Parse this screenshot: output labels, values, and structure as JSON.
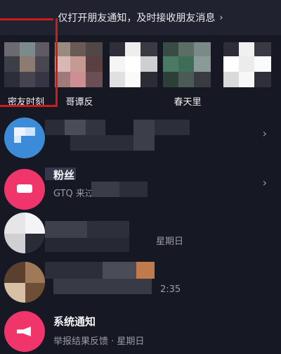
{
  "notification_banner": {
    "text": "仅打开朋友通知，及时接收朋友消息",
    "chevron": "chevron-right-icon"
  },
  "stories": [
    {
      "label": "密友时刻",
      "highlighted": true
    },
    {
      "label": "哥谭反"
    },
    {
      "label": ""
    },
    {
      "label": "春天里"
    },
    {
      "label": ""
    }
  ],
  "rows": [
    {
      "title": "",
      "subtitle": "",
      "avatar_color": "#3b8bd9",
      "icon": "chat-icon",
      "has_chevron": true
    },
    {
      "title": "粉丝",
      "subtitle": "GTQ 来过你的主页",
      "avatar_color": "#f0356a",
      "icon": "person-icon",
      "has_chevron": true
    },
    {
      "title": "",
      "subtitle": "星期日",
      "avatar_color": "#d8d8dc",
      "icon": "",
      "has_chevron": false
    },
    {
      "title": "",
      "subtitle": "2:35",
      "avatar_color": "#7b5a3a",
      "icon": "",
      "has_chevron": false
    },
    {
      "title": "系统通知",
      "subtitle": "举报结果反馈 · 星期日",
      "avatar_color": "#f0356a",
      "icon": "megaphone-icon",
      "has_chevron": false
    }
  ],
  "colors": {
    "background": "#161823",
    "banner": "#202230",
    "highlight_red": "#d31a1a",
    "accent_pink": "#f0356a",
    "accent_blue": "#3b8bd9"
  }
}
